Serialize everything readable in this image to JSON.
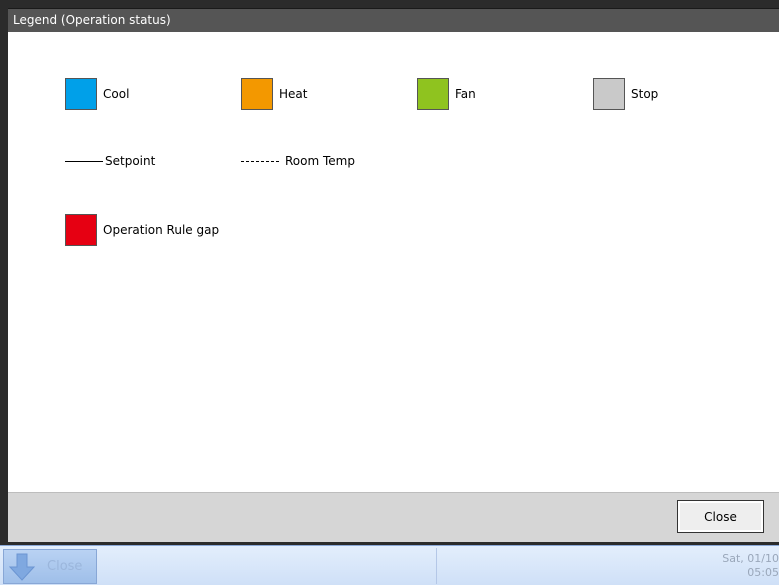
{
  "dialog": {
    "title": "Legend (Operation status)",
    "close_label": "Close"
  },
  "legend": {
    "items": [
      {
        "label": "Cool",
        "color": "#00a0e9"
      },
      {
        "label": "Heat",
        "color": "#f39800"
      },
      {
        "label": "Fan",
        "color": "#8fc31f"
      },
      {
        "label": "Stop",
        "color": "#c9c9c9"
      }
    ],
    "setpoint_label": "Setpoint",
    "room_temp_label": "Room Temp",
    "rule_gap": {
      "label": "Operation Rule gap",
      "color": "#e60012"
    }
  },
  "taskbar": {
    "button_label": "Close",
    "date": "Sat, 01/10",
    "time": "05:05"
  }
}
